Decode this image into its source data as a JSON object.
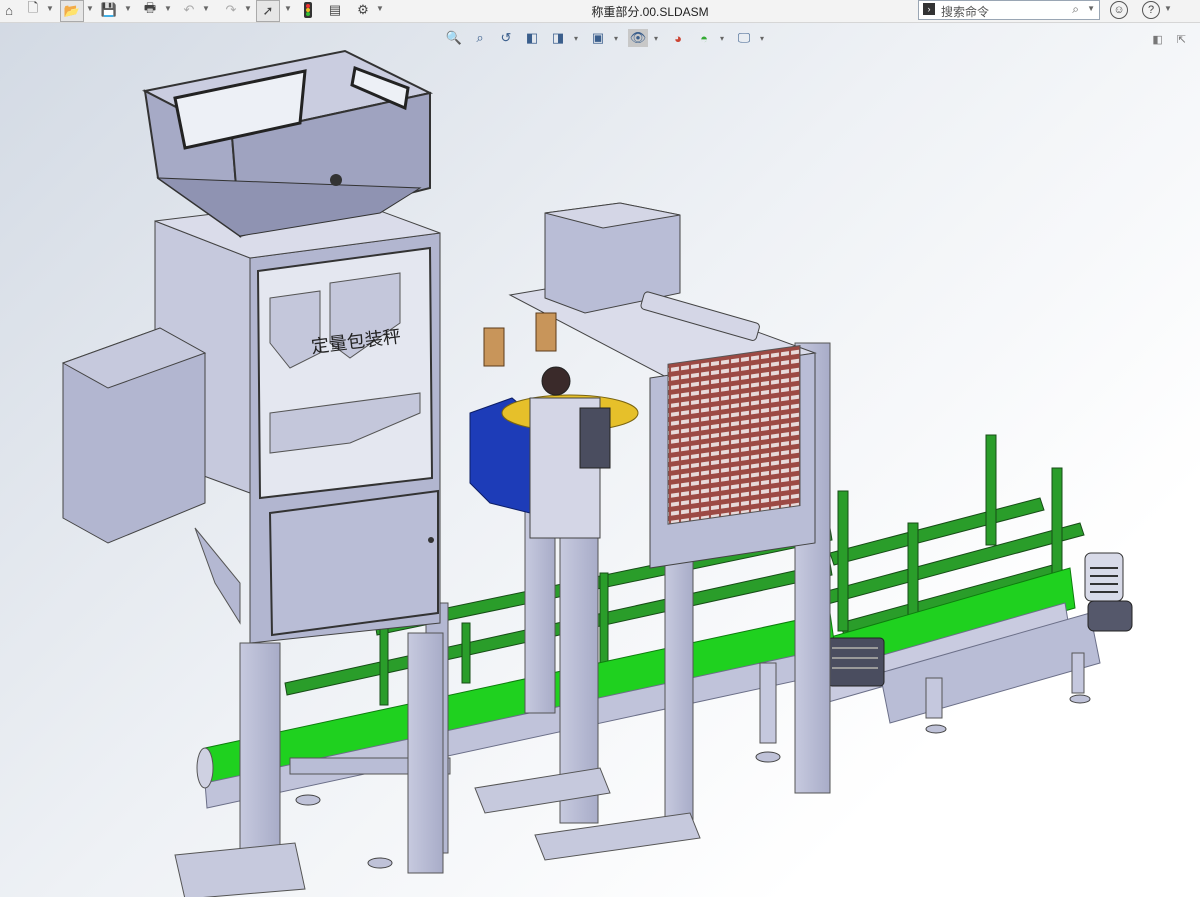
{
  "titlebar": {
    "doc_title": "称重部分.00.SLDASM",
    "search_placeholder": "搜索命令",
    "icons": [
      "home-icon",
      "new-doc-icon",
      "open-icon",
      "save-icon",
      "print-icon",
      "undo-icon",
      "redo-icon",
      "select-icon",
      "rebuild-icon",
      "file-props-icon",
      "options-icon"
    ]
  },
  "heads_up_toolbar": {
    "icons": [
      "zoom-to-fit-icon",
      "zoom-area-icon",
      "previous-view-icon",
      "section-view-icon",
      "view-orientation-icon",
      "display-style-icon",
      "hide-show-icon",
      "edit-appearance-icon",
      "scene-icon",
      "view-settings-icon"
    ]
  },
  "model": {
    "machine_label": "定量包装秤"
  },
  "colors": {
    "frame": "#b4b8d2",
    "frame_dark": "#7b7f98",
    "conveyor": "#1fd11f",
    "green_frame": "#2a9d2a",
    "motor_blue": "#1d3cb8",
    "cabinet_red": "#9c4a44",
    "spool": "#c8955a"
  }
}
